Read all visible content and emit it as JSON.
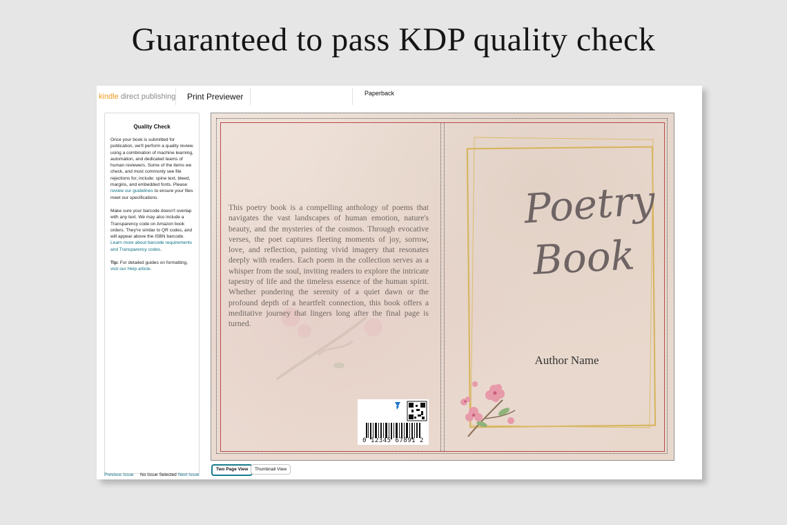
{
  "headline": "Guaranteed to pass KDP quality check",
  "header": {
    "brand_kindle": "kindle",
    "brand_rest": "direct publishing",
    "previewer_tab": "Print Previewer",
    "format_tab": "Paperback"
  },
  "sidebar": {
    "title": "Quality Check",
    "p1_text": "Once your book is submitted for publication, we'll perform a quality review using a combination of machine learning, automation, and dedicated teams of human reviewers. Some of the items we check, and most commonly see file rejections for, include: spine text, bleed, margins, and embedded fonts. Please ",
    "p1_link": "review our guidelines",
    "p1_tail": " to ensure your files meet our specifications.",
    "p2_text": "Make sure your barcode doesn't overlap with any text. We may also include a Transparency code on Amazon book orders. They're similar to QR codes, and will appear above the ISBN barcode. ",
    "p2_link": "Learn more about barcode requirements and Transparency codes",
    "p2_tail": ".",
    "tip_label": "Tip:",
    "tip_text": " For detailed guides on formatting, ",
    "tip_link": "visit our Help article",
    "tip_tail": "."
  },
  "bottom_nav": {
    "previous": "Previous Issue",
    "status": "No Issue Selected",
    "next": "Next Issue"
  },
  "view_buttons": {
    "two_page": "Two Page View",
    "thumbnail": "Thumbnail View"
  },
  "cover": {
    "back_blurb": "This poetry book is a compelling anthology of poems that navigates the vast landscapes of human emotion, nature's beauty, and the mysteries of the cosmos. Through evocative verses, the poet captures fleeting moments of joy, sorrow, love, and reflection, painting vivid imagery that resonates deeply with readers. Each poem in the collection serves as a whisper from the soul, inviting readers to explore the intricate tapestry of life and the timeless essence of the human spirit. Whether pondering the serenity of a quiet dawn or the profound depth of a heartfelt connection, this book offers a meditative journey that lingers long after the final page is turned.",
    "title_line1": "Poetry",
    "title_line2": "Book",
    "author": "Author Name",
    "barcode_digits": "0 12345 67891 2",
    "colors": {
      "gold": "#d6b35c",
      "border_red": "#b74848",
      "paper": "#ece0d6",
      "blossom": "#e79aa9"
    }
  }
}
